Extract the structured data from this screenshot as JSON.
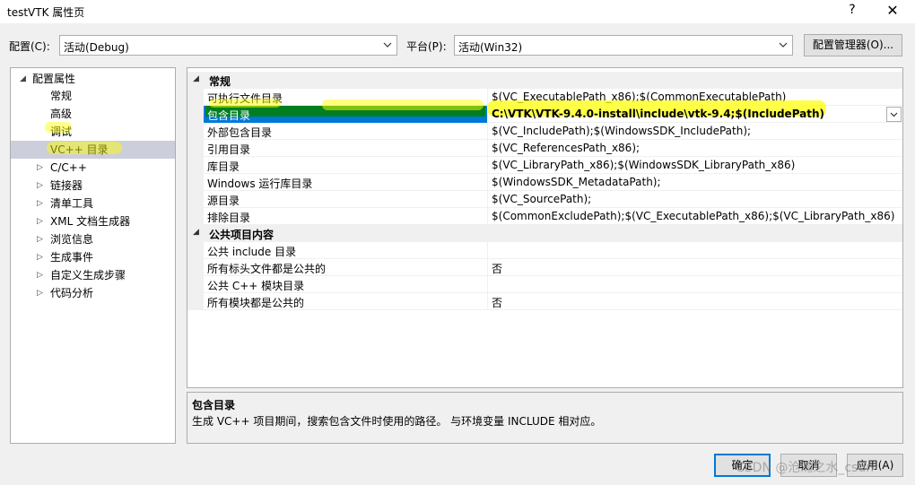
{
  "window": {
    "title": "testVTK 属性页",
    "help": "?",
    "close": "✕"
  },
  "config": {
    "label": "配置(C):",
    "value": "活动(Debug)"
  },
  "platform": {
    "label": "平台(P):",
    "value": "活动(Win32)"
  },
  "config_manager_label": "配置管理器(O)...",
  "tree": {
    "root": "配置属性",
    "items": [
      "常规",
      "高级",
      "调试",
      "VC++ 目录"
    ],
    "groups": [
      "C/C++",
      "链接器",
      "清单工具",
      "XML 文档生成器",
      "浏览信息",
      "生成事件",
      "自定义生成步骤",
      "代码分析"
    ]
  },
  "grid": {
    "cat_general": "常规",
    "rows": [
      {
        "name": "可执行文件目录",
        "value": "$(VC_ExecutablePath_x86);$(CommonExecutablePath)"
      },
      {
        "name": "包含目录",
        "value": "C:\\VTK\\VTK-9.4.0-install\\include\\vtk-9.4;$(IncludePath)"
      },
      {
        "name": "外部包含目录",
        "value": "$(VC_IncludePath);$(WindowsSDK_IncludePath);"
      },
      {
        "name": "引用目录",
        "value": "$(VC_ReferencesPath_x86);"
      },
      {
        "name": "库目录",
        "value": "$(VC_LibraryPath_x86);$(WindowsSDK_LibraryPath_x86)"
      },
      {
        "name": "Windows 运行库目录",
        "value": "$(WindowsSDK_MetadataPath);"
      },
      {
        "name": "源目录",
        "value": "$(VC_SourcePath);"
      },
      {
        "name": "排除目录",
        "value": "$(CommonExcludePath);$(VC_ExecutablePath_x86);$(VC_LibraryPath_x86)"
      }
    ],
    "cat_public": "公共项目内容",
    "public_rows": [
      {
        "name": "公共 include 目录",
        "value": ""
      },
      {
        "name": "所有标头文件都是公共的",
        "value": "否"
      },
      {
        "name": "公共 C++ 模块目录",
        "value": ""
      },
      {
        "name": "所有模块都是公共的",
        "value": "否"
      }
    ]
  },
  "description": {
    "title": "包含目录",
    "text": "生成 VC++ 项目期间，搜索包含文件时使用的路径。 与环境变量 INCLUDE 相对应。"
  },
  "buttons": {
    "ok": "确定",
    "cancel": "取消",
    "apply": "应用(A)"
  },
  "watermark": "CSDN @沧瀚之水_csdn",
  "colors": {
    "selection": "#0078d7",
    "tree_selection": "#cccedb",
    "highlight_yellow": "#ffff00",
    "highlight_green": "#008000"
  }
}
